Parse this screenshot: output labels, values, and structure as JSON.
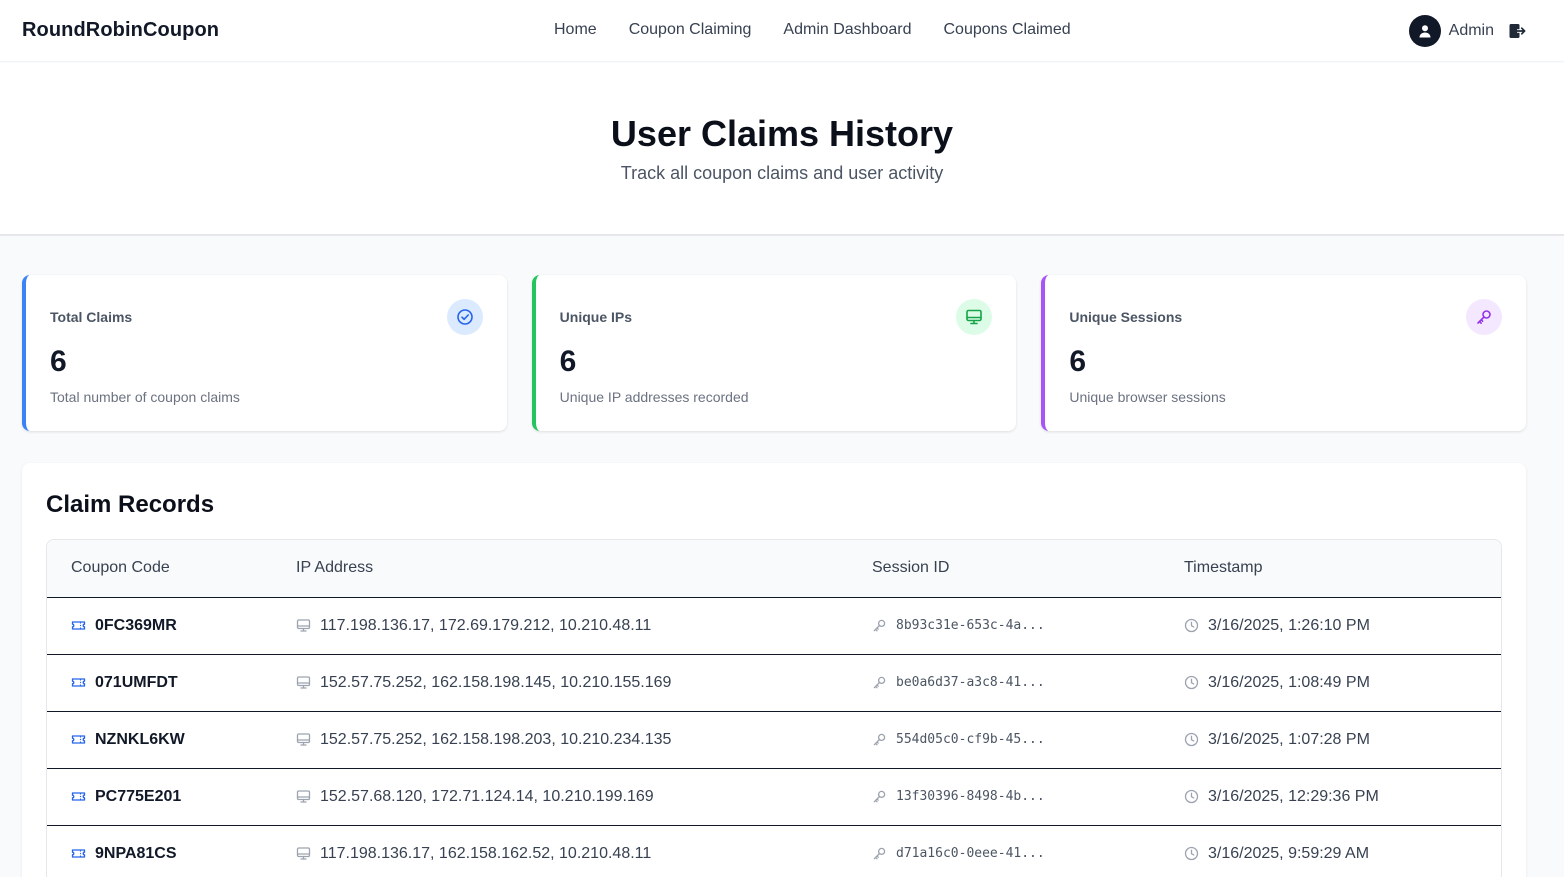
{
  "nav": {
    "brand": "RoundRobinCoupon",
    "links": [
      "Home",
      "Coupon Claiming",
      "Admin Dashboard",
      "Coupons Claimed"
    ],
    "user_name": "Admin",
    "user_icon": "user-avatar-icon",
    "logout_icon": "logout-icon"
  },
  "hero": {
    "title": "User Claims History",
    "subtitle": "Track all coupon claims and user activity"
  },
  "stats": [
    {
      "title": "Total Claims",
      "value": "6",
      "description": "Total number of coupon claims",
      "icon": "check-circle-icon",
      "accent": "#3b82f6",
      "icon_bg": "#dbeafe",
      "icon_color": "#2563eb"
    },
    {
      "title": "Unique IPs",
      "value": "6",
      "description": "Unique IP addresses recorded",
      "icon": "monitor-icon",
      "accent": "#22c55e",
      "icon_bg": "#dcfce7",
      "icon_color": "#16a34a"
    },
    {
      "title": "Unique Sessions",
      "value": "6",
      "description": "Unique browser sessions",
      "icon": "key-icon",
      "accent": "#a855f7",
      "icon_bg": "#f3e8ff",
      "icon_color": "#9333ea"
    }
  ],
  "records": {
    "title": "Claim Records",
    "columns": [
      "Coupon Code",
      "IP Address",
      "Session ID",
      "Timestamp"
    ],
    "rows": [
      {
        "code": "0FC369MR",
        "ip": "117.198.136.17, 172.69.179.212, 10.210.48.11",
        "session": "8b93c31e-653c-4a...",
        "timestamp": "3/16/2025, 1:26:10 PM"
      },
      {
        "code": "071UMFDT",
        "ip": "152.57.75.252, 162.158.198.145, 10.210.155.169",
        "session": "be0a6d37-a3c8-41...",
        "timestamp": "3/16/2025, 1:08:49 PM"
      },
      {
        "code": "NZNKL6KW",
        "ip": "152.57.75.252, 162.158.198.203, 10.210.234.135",
        "session": "554d05c0-cf9b-45...",
        "timestamp": "3/16/2025, 1:07:28 PM"
      },
      {
        "code": "PC775E201",
        "ip": "152.57.68.120, 172.71.124.14, 10.210.199.169",
        "session": "13f30396-8498-4b...",
        "timestamp": "3/16/2025, 12:29:36 PM"
      },
      {
        "code": "9NPA81CS",
        "ip": "117.198.136.17, 162.158.162.52, 10.210.48.11",
        "session": "d71a16c0-0eee-41...",
        "timestamp": "3/16/2025, 9:59:29 AM"
      }
    ],
    "row_icons": {
      "code": "ticket-icon",
      "ip": "monitor-icon",
      "session": "key-icon",
      "timestamp": "clock-icon"
    }
  }
}
